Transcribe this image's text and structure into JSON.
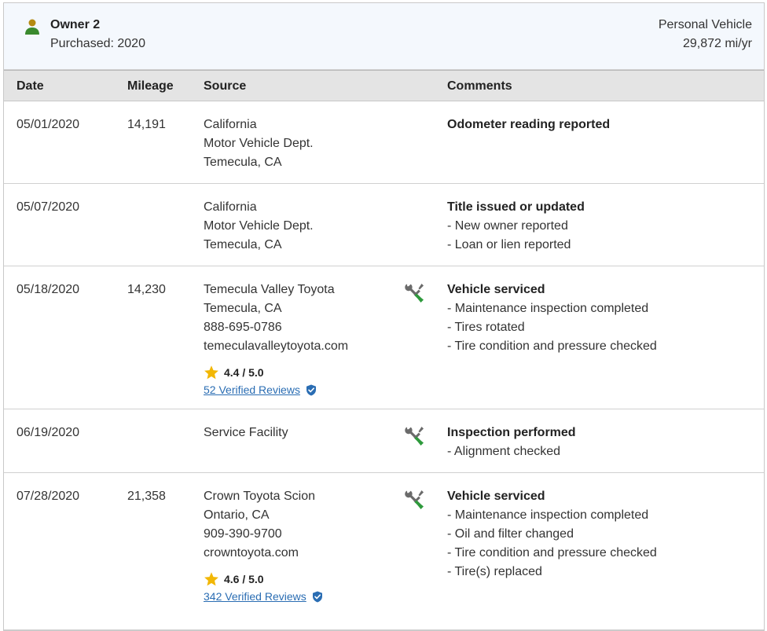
{
  "owner": {
    "name": "Owner 2",
    "purchased": "Purchased: 2020",
    "vehicle_type": "Personal Vehicle",
    "miles_per_year": "29,872 mi/yr"
  },
  "table": {
    "headers": {
      "date": "Date",
      "mileage": "Mileage",
      "source": "Source",
      "comments": "Comments"
    },
    "rows": [
      {
        "date": "05/01/2020",
        "mileage": "14,191",
        "source": [
          "California",
          "Motor Vehicle Dept.",
          "Temecula, CA"
        ],
        "comment_title": "Odometer reading reported",
        "comment_items": []
      },
      {
        "date": "05/07/2020",
        "mileage": "",
        "source": [
          "California",
          "Motor Vehicle Dept.",
          "Temecula, CA"
        ],
        "comment_title": "Title issued or updated",
        "comment_items": [
          "- New owner reported",
          "- Loan or lien reported"
        ]
      },
      {
        "date": "05/18/2020",
        "mileage": "14,230",
        "source": [
          "Temecula Valley Toyota",
          "Temecula, CA",
          "888-695-0786",
          "temeculavalleytoyota.com"
        ],
        "rating": "4.4 / 5.0",
        "reviews": "52 Verified Reviews",
        "icon": "wrench-screwdriver-icon",
        "comment_title": "Vehicle serviced",
        "comment_items": [
          "- Maintenance inspection completed",
          "- Tires rotated",
          "- Tire condition and pressure checked"
        ]
      },
      {
        "date": "06/19/2020",
        "mileage": "",
        "source": [
          "Service Facility"
        ],
        "icon": "wrench-screwdriver-icon",
        "comment_title": "Inspection performed",
        "comment_items": [
          "- Alignment checked"
        ]
      },
      {
        "date": "07/28/2020",
        "mileage": "21,358",
        "source": [
          "Crown Toyota Scion",
          "Ontario, CA",
          "909-390-9700",
          "crowntoyota.com"
        ],
        "rating": "4.6 / 5.0",
        "reviews": "342 Verified Reviews",
        "icon": "wrench-screwdriver-icon",
        "comment_title": "Vehicle serviced",
        "comment_items": [
          "- Maintenance inspection completed",
          "- Oil and filter changed",
          "- Tire condition and pressure checked",
          "- Tire(s) replaced"
        ]
      }
    ]
  },
  "colors": {
    "header_bg": "#f4f8fd",
    "table_header_bg": "#e4e4e4",
    "link": "#2a6db3",
    "star": "#f2b705",
    "icon_green": "#2e9a3c",
    "icon_gray": "#6b6b6b",
    "person_gold": "#b58a12",
    "person_green": "#3a8a2e"
  }
}
